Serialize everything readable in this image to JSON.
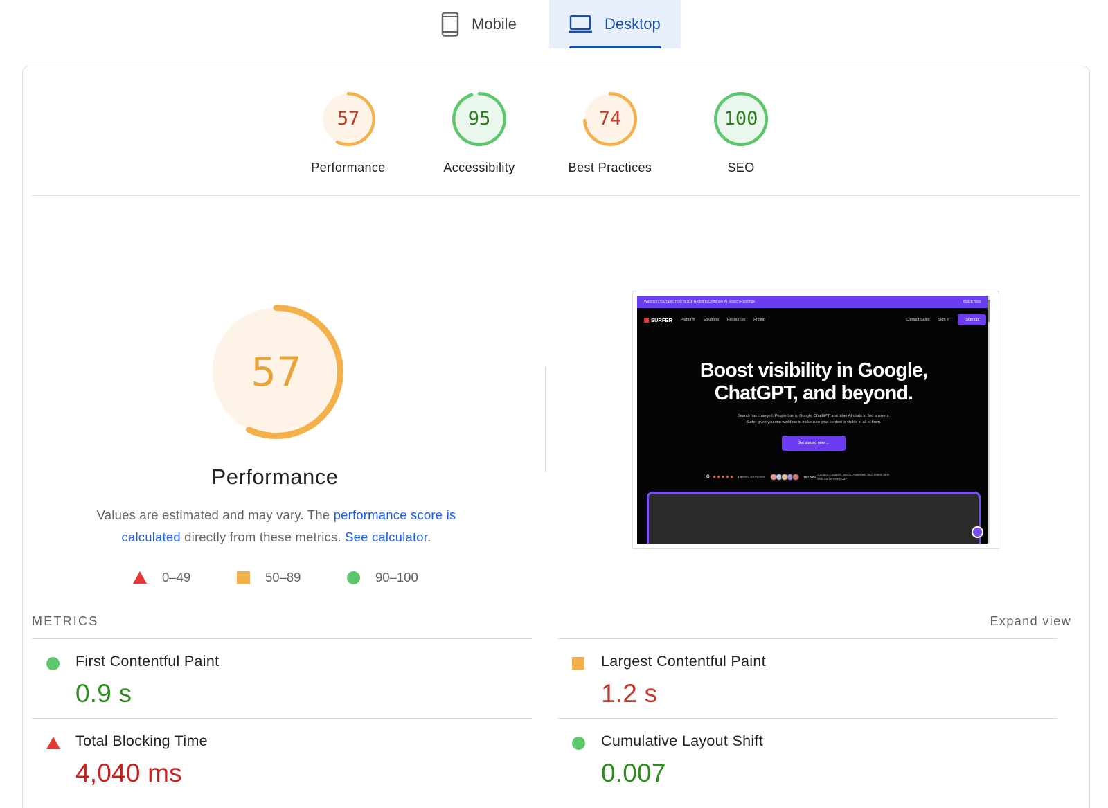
{
  "tabs": {
    "mobile": {
      "label": "Mobile",
      "icon": "phone-icon"
    },
    "desktop": {
      "label": "Desktop",
      "icon": "laptop-icon",
      "selected": true
    }
  },
  "scores": [
    {
      "id": "performance",
      "value": "57",
      "label": "Performance",
      "score": 57,
      "color": "#f4b04b",
      "text_color": "#c0392b",
      "bg": "#fdf4e7"
    },
    {
      "id": "accessibility",
      "value": "95",
      "label": "Accessibility",
      "score": 95,
      "color": "#5ec66d",
      "text_color": "#2e7d1e",
      "bg": "#eaf7ec"
    },
    {
      "id": "best-practices",
      "value": "74",
      "label": "Best Practices",
      "score": 74,
      "color": "#f4b04b",
      "text_color": "#c0392b",
      "bg": "#fdf4e7"
    },
    {
      "id": "seo",
      "value": "100",
      "label": "SEO",
      "score": 100,
      "color": "#5ec66d",
      "text_color": "#2e7d1e",
      "bg": "#eaf7ec"
    }
  ],
  "main_gauge": {
    "value": "57",
    "score": 57,
    "title": "Performance",
    "color": "#f4b04b",
    "bg": "#fdf4e7"
  },
  "description": {
    "text1": "Values are estimated and may vary. The ",
    "link1": "performance score is calculated",
    "text2": " directly from these metrics. ",
    "link2": "See calculator",
    "text3": "."
  },
  "legend": {
    "low": "0–49",
    "mid": "50–89",
    "high": "90–100"
  },
  "screenshot": {
    "banner": "Watch on YouTube: How to Use Reddit to Dominate AI Search Rankings",
    "banner_right": "Watch Now",
    "logo": "SURFER",
    "nav": [
      "Platform",
      "Solutions",
      "Resources",
      "Pricing"
    ],
    "nav_right": [
      "Contact Sales",
      "Sign in"
    ],
    "signup": "Sign up",
    "headline1": "Boost visibility in Google,",
    "headline2": "ChatGPT, and beyond.",
    "sub1": "Search has changed. People turn to Google, ChatGPT, and other AI chats to find answers.",
    "sub2": "Surfer gives you one workflow to make sure your content is visible in all of them.",
    "cta": "Get started now →",
    "rating": "4.8",
    "reviews": "500+ REVIEWS",
    "users": "150,000+",
    "users_text": "Content Creators, SEOs, Agencies, and Teams rank with Surfer every day"
  },
  "metrics": {
    "heading": "METRICS",
    "expand": "Expand view",
    "items": [
      {
        "label": "First Contentful Paint",
        "value": "0.9 s",
        "status": "good"
      },
      {
        "label": "Largest Contentful Paint",
        "value": "1.2 s",
        "status": "average"
      },
      {
        "label": "Total Blocking Time",
        "value": "4,040 ms",
        "status": "poor"
      },
      {
        "label": "Cumulative Layout Shift",
        "value": "0.007",
        "status": "good"
      }
    ]
  }
}
